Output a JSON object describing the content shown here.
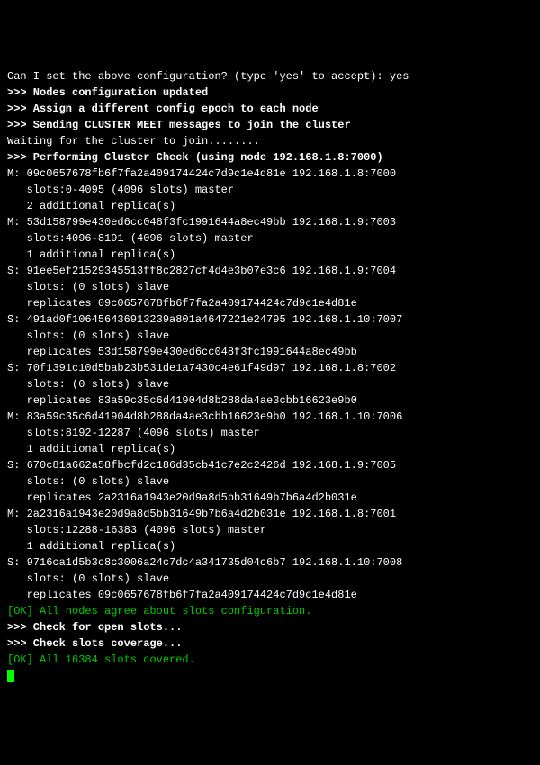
{
  "lines": [
    {
      "text": "Can I set the above configuration? (type 'yes' to accept): yes",
      "cls": ""
    },
    {
      "text": ">>> Nodes configuration updated",
      "cls": "bold"
    },
    {
      "text": ">>> Assign a different config epoch to each node",
      "cls": "bold"
    },
    {
      "text": ">>> Sending CLUSTER MEET messages to join the cluster",
      "cls": "bold"
    },
    {
      "text": "Waiting for the cluster to join........",
      "cls": ""
    },
    {
      "text": ">>> Performing Cluster Check (using node 192.168.1.8:7000)",
      "cls": "bold"
    },
    {
      "text": "M: 09c0657678fb6f7fa2a409174424c7d9c1e4d81e 192.168.1.8:7000",
      "cls": ""
    },
    {
      "text": "   slots:0-4095 (4096 slots) master",
      "cls": ""
    },
    {
      "text": "   2 additional replica(s)",
      "cls": ""
    },
    {
      "text": "M: 53d158799e430ed6cc048f3fc1991644a8ec49bb 192.168.1.9:7003",
      "cls": ""
    },
    {
      "text": "   slots:4096-8191 (4096 slots) master",
      "cls": ""
    },
    {
      "text": "   1 additional replica(s)",
      "cls": ""
    },
    {
      "text": "S: 91ee5ef21529345513ff8c2827cf4d4e3b07e3c6 192.168.1.9:7004",
      "cls": ""
    },
    {
      "text": "   slots: (0 slots) slave",
      "cls": ""
    },
    {
      "text": "   replicates 09c0657678fb6f7fa2a409174424c7d9c1e4d81e",
      "cls": ""
    },
    {
      "text": "S: 491ad0f106456436913239a801a4647221e24795 192.168.1.10:7007",
      "cls": ""
    },
    {
      "text": "   slots: (0 slots) slave",
      "cls": ""
    },
    {
      "text": "   replicates 53d158799e430ed6cc048f3fc1991644a8ec49bb",
      "cls": ""
    },
    {
      "text": "S: 70f1391c10d5bab23b531de1a7430c4e61f49d97 192.168.1.8:7002",
      "cls": ""
    },
    {
      "text": "   slots: (0 slots) slave",
      "cls": ""
    },
    {
      "text": "   replicates 83a59c35c6d41904d8b288da4ae3cbb16623e9b0",
      "cls": ""
    },
    {
      "text": "M: 83a59c35c6d41904d8b288da4ae3cbb16623e9b0 192.168.1.10:7006",
      "cls": ""
    },
    {
      "text": "   slots:8192-12287 (4096 slots) master",
      "cls": ""
    },
    {
      "text": "   1 additional replica(s)",
      "cls": ""
    },
    {
      "text": "S: 670c81a662a58fbcfd2c186d35cb41c7e2c2426d 192.168.1.9:7005",
      "cls": ""
    },
    {
      "text": "   slots: (0 slots) slave",
      "cls": ""
    },
    {
      "text": "   replicates 2a2316a1943e20d9a8d5bb31649b7b6a4d2b031e",
      "cls": ""
    },
    {
      "text": "M: 2a2316a1943e20d9a8d5bb31649b7b6a4d2b031e 192.168.1.8:7001",
      "cls": ""
    },
    {
      "text": "   slots:12288-16383 (4096 slots) master",
      "cls": ""
    },
    {
      "text": "   1 additional replica(s)",
      "cls": ""
    },
    {
      "text": "S: 9716ca1d5b3c8c3006a24c7dc4a341735d04c6b7 192.168.1.10:7008",
      "cls": ""
    },
    {
      "text": "   slots: (0 slots) slave",
      "cls": ""
    },
    {
      "text": "   replicates 09c0657678fb6f7fa2a409174424c7d9c1e4d81e",
      "cls": ""
    },
    {
      "text": "[OK] All nodes agree about slots configuration.",
      "cls": "green"
    },
    {
      "text": ">>> Check for open slots...",
      "cls": "bold"
    },
    {
      "text": ">>> Check slots coverage...",
      "cls": "bold"
    },
    {
      "text": "[OK] All 16384 slots covered.",
      "cls": "green"
    }
  ],
  "prompt_prefix": ""
}
